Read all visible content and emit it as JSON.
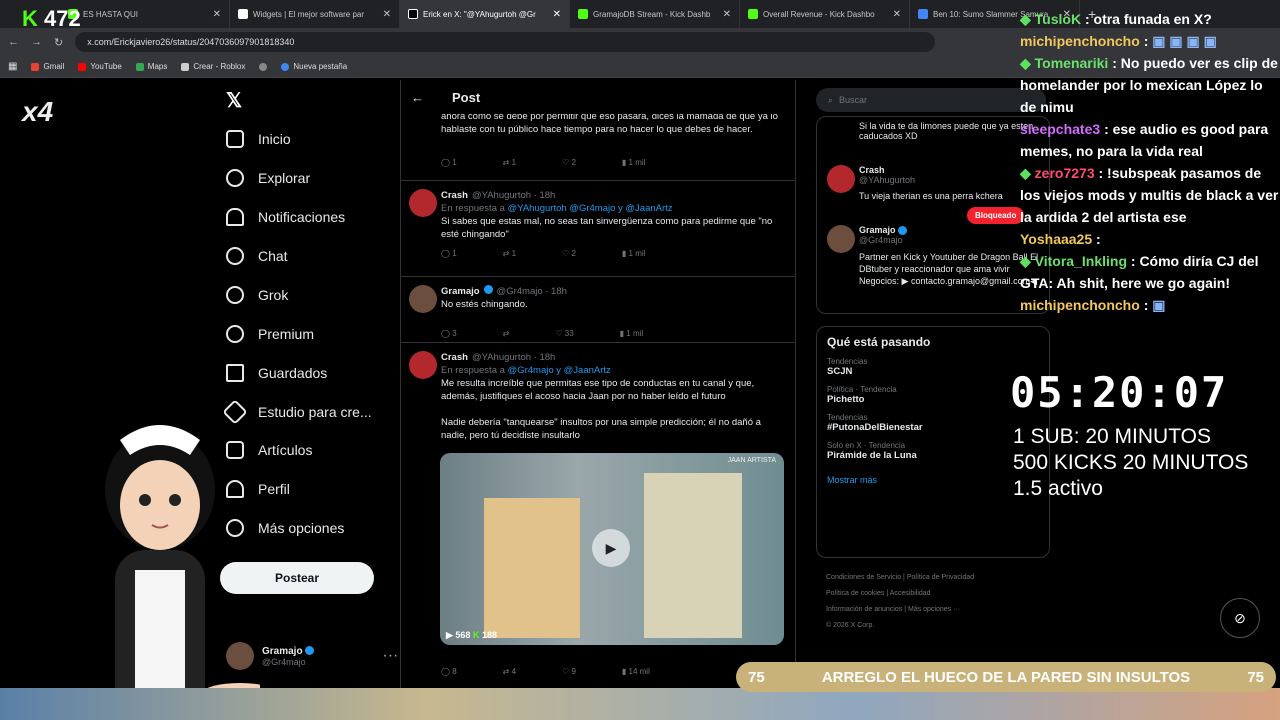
{
  "browser": {
    "tabs": [
      {
        "label": "ES HASTA QUI",
        "active": false
      },
      {
        "label": "Widgets | El mejor software par",
        "active": false
      },
      {
        "label": "Erick en X: \"@YAhugurtoh @Gr",
        "active": true
      },
      {
        "label": "GramajoDB Stream - Kick Dashb",
        "active": false
      },
      {
        "label": "Overall Revenue - Kick Dashbo",
        "active": false
      },
      {
        "label": "Ben 10: Sumo Slammer Samura",
        "active": false
      }
    ],
    "url": "x.com/Erickjaviero26/status/2047036097901818340",
    "bookmarks": [
      "Gmail",
      "YouTube",
      "Maps",
      "Crear - Roblox",
      "Nueva pestaña"
    ]
  },
  "overlay": {
    "kick_count": "472",
    "multiplier": "x4",
    "timer": "05:20:07",
    "sub_line1": "1 SUB: 20  MINUTOS",
    "sub_line2": "500 KICKS 20 MINUTOS",
    "sub_line3": "1.5 activo",
    "banner_left": "75",
    "banner_text": "ARREGLO EL HUECO DE LA PARED SIN INSULTOS",
    "banner_right": "75"
  },
  "chat": [
    {
      "user": "TusloK",
      "msg": ": otra funada en X?"
    },
    {
      "user": "michipenchoncho",
      "msg": ":"
    },
    {
      "user": "Tomenariki",
      "msg": ": No puedo ver es clip de homelander por lo mexican López lo de nimu"
    },
    {
      "user": "sleepchate3",
      "msg": ": ese audio es good para memes, no para la vida real"
    },
    {
      "user": "zero7273",
      "msg": ": !subspeak pasamos de los viejos mods y multis de black a ver la ardida 2 del artista ese"
    },
    {
      "user": "Yoshaaa25",
      "msg": ":"
    },
    {
      "user": "Vitora_Inkling",
      "msg": ": Cómo diría CJ del GTA: Ah shit, here we go again!"
    },
    {
      "user": "michipenchoncho",
      "msg": ":"
    }
  ],
  "xnav": {
    "items": [
      "Inicio",
      "Explorar",
      "Notificaciones",
      "Chat",
      "Grok",
      "Premium",
      "Guardados",
      "Estudio para cre...",
      "Artículos",
      "Perfil",
      "Más opciones"
    ],
    "post_button": "Postear",
    "me_name": "Gramajo",
    "me_handle": "@Gr4majo"
  },
  "feed": {
    "title": "Post",
    "top_text": "ahora como se debe por permitir que eso pasara, dices la mamada de que ya lo hablaste con tu público hace tiempo para no hacer lo que debes de hacer.",
    "top_acts": [
      "1",
      "1",
      "2",
      "1 mil"
    ],
    "tweets": [
      {
        "name": "Crash",
        "handle": "@YAhugurtoh · 18h",
        "reply_prefix": "En respuesta a ",
        "reply_to": "@YAhugurtoh @Gr4majo y @JaanArtz",
        "text": "Si sabes que estas mal, no seas tan sinvergüenza como para pedirme que \"no esté chingando\"",
        "acts": [
          "1",
          "1",
          "2",
          "1 mil"
        ]
      },
      {
        "name": "Gramajo",
        "handle": "@Gr4majo · 18h",
        "text": "No estés chingando.",
        "acts": [
          "3",
          "",
          "33",
          "1 mil"
        ]
      },
      {
        "name": "Crash",
        "handle": "@YAhugurtoh · 18h",
        "reply_prefix": "En respuesta a ",
        "reply_to": "@Gr4majo y @JaanArtz",
        "text": "Me resulta increíble que permitas ese tipo de conductas en tu canal y que, además, justifiques el acoso hacia Jaan por no haber leído el futuro",
        "text2": "Nadie debería \"tanquearse\" insultos por una simple predicción; él no dañó a nadie, pero tú decidiste insultarlo",
        "acts": [
          "8",
          "4",
          "9",
          "14 mil"
        ],
        "media_label": "JAAN ARTISTA",
        "media_counts": [
          "568",
          "188"
        ]
      }
    ]
  },
  "right": {
    "search_placeholder": "Buscar",
    "who": [
      {
        "text": "Si la vida te da limones puede que ya esten caducados XD"
      },
      {
        "name": "Crash",
        "handle": "@YAhugurtoh",
        "bio": "Tu vieja therian es una perra kchera",
        "badge": "Bloqueado"
      },
      {
        "name": "Gramajo",
        "handle": "@Gr4majo",
        "bio": "Partner en Kick y Youtuber de Dragon Ball El DBtuber y reaccionador que ama vivir Negocios: ▶ contacto.gramajo@gmail.com◀"
      }
    ],
    "trends_title": "Qué está pasando",
    "trends": [
      {
        "cat": "Tendencias",
        "name": "SCJN"
      },
      {
        "cat": "Política · Tendencia",
        "name": "Pichetto"
      },
      {
        "cat": "Tendencias",
        "name": "#PutonaDelBienestar"
      },
      {
        "cat": "Solo en X · Tendencia",
        "name": "Pirámide de la Luna"
      }
    ],
    "show_more": "Mostrar más",
    "footer": [
      "Condiciones de Servicio",
      "Política de Privacidad",
      "Política de cookies",
      "Accesibilidad",
      "Información de anuncios",
      "Más opciones ···",
      "© 2026 X Corp."
    ]
  },
  "colors": {
    "accent": "#1d9bf0",
    "kick_green": "#53fc18",
    "chat_user": "#f2c75c"
  }
}
